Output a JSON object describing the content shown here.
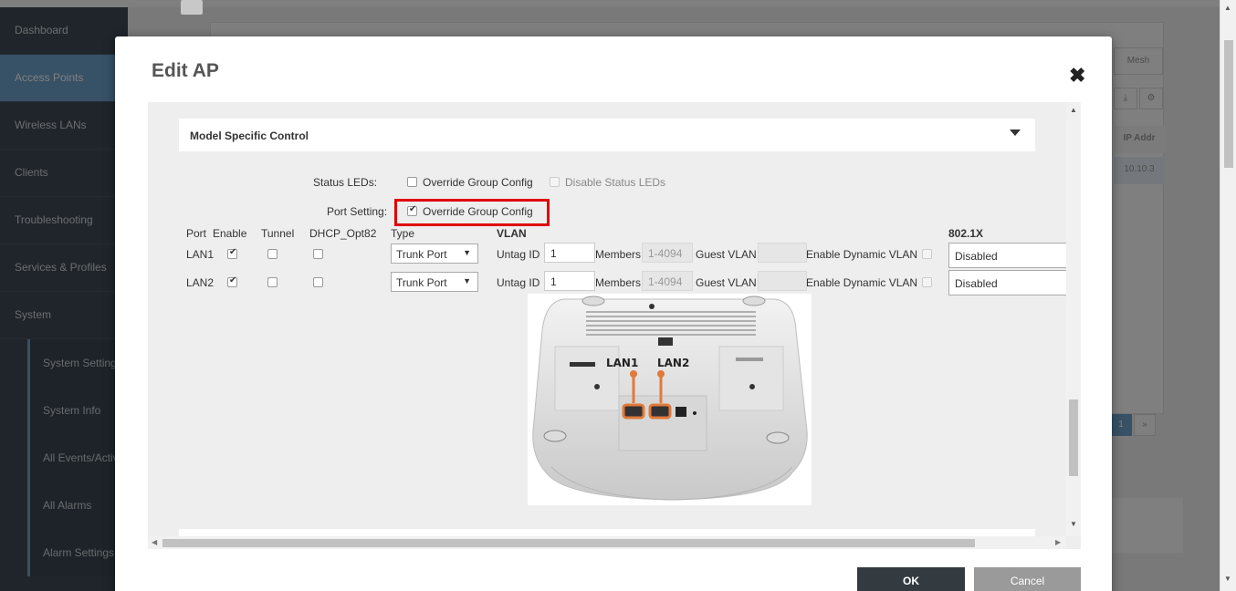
{
  "sidebar": {
    "items": [
      {
        "label": "Dashboard"
      },
      {
        "label": "Access Points"
      },
      {
        "label": "Wireless LANs"
      },
      {
        "label": "Clients"
      },
      {
        "label": "Troubleshooting"
      },
      {
        "label": "Services & Profiles"
      },
      {
        "label": "System"
      }
    ],
    "subitems": [
      {
        "label": "System Settings"
      },
      {
        "label": "System Info"
      },
      {
        "label": "All Events/Activities"
      },
      {
        "label": "All Alarms"
      },
      {
        "label": "Alarm Settings"
      }
    ]
  },
  "background": {
    "mesh_tab": "Mesh",
    "ip_header": "IP Addr",
    "ip_value": "10.10.3",
    "page_number": "1",
    "page_next": "»"
  },
  "modal": {
    "title": "Edit AP",
    "close_icon": "close-icon",
    "section_title": "Model Specific Control",
    "status_leds_label": "Status LEDs:",
    "override_group_config": "Override Group Config",
    "disable_status_leds": "Disable Status LEDs",
    "port_setting_label": "Port Setting:",
    "port_setting_override": "Override Group Config",
    "ok_label": "OK",
    "cancel_label": "Cancel"
  },
  "port_table": {
    "headers": {
      "port": "Port",
      "enable": "Enable",
      "tunnel": "Tunnel",
      "dhcp": "DHCP_Opt82",
      "type": "Type",
      "vlan": "VLAN",
      "dot1x": "802.1X"
    },
    "rows": [
      {
        "port": "LAN1",
        "enable": true,
        "tunnel": false,
        "dhcp": false,
        "type": "Trunk Port",
        "untag_label": "Untag ID",
        "untag_id": "1",
        "members_label": "Members",
        "members": "1-4094",
        "guest_label": "Guest VLAN",
        "guest_vlan": "",
        "dynamic_label": "Enable Dynamic VLAN",
        "dot1x": "Disabled"
      },
      {
        "port": "LAN2",
        "enable": true,
        "tunnel": false,
        "dhcp": false,
        "type": "Trunk Port",
        "untag_label": "Untag ID",
        "untag_id": "1",
        "members_label": "Members",
        "members": "1-4094",
        "guest_label": "Guest VLAN",
        "guest_vlan": "",
        "dynamic_label": "Enable Dynamic VLAN",
        "dot1x": "Disabled"
      }
    ]
  },
  "ap_image": {
    "lan1_label": "LAN1",
    "lan2_label": "LAN2"
  }
}
